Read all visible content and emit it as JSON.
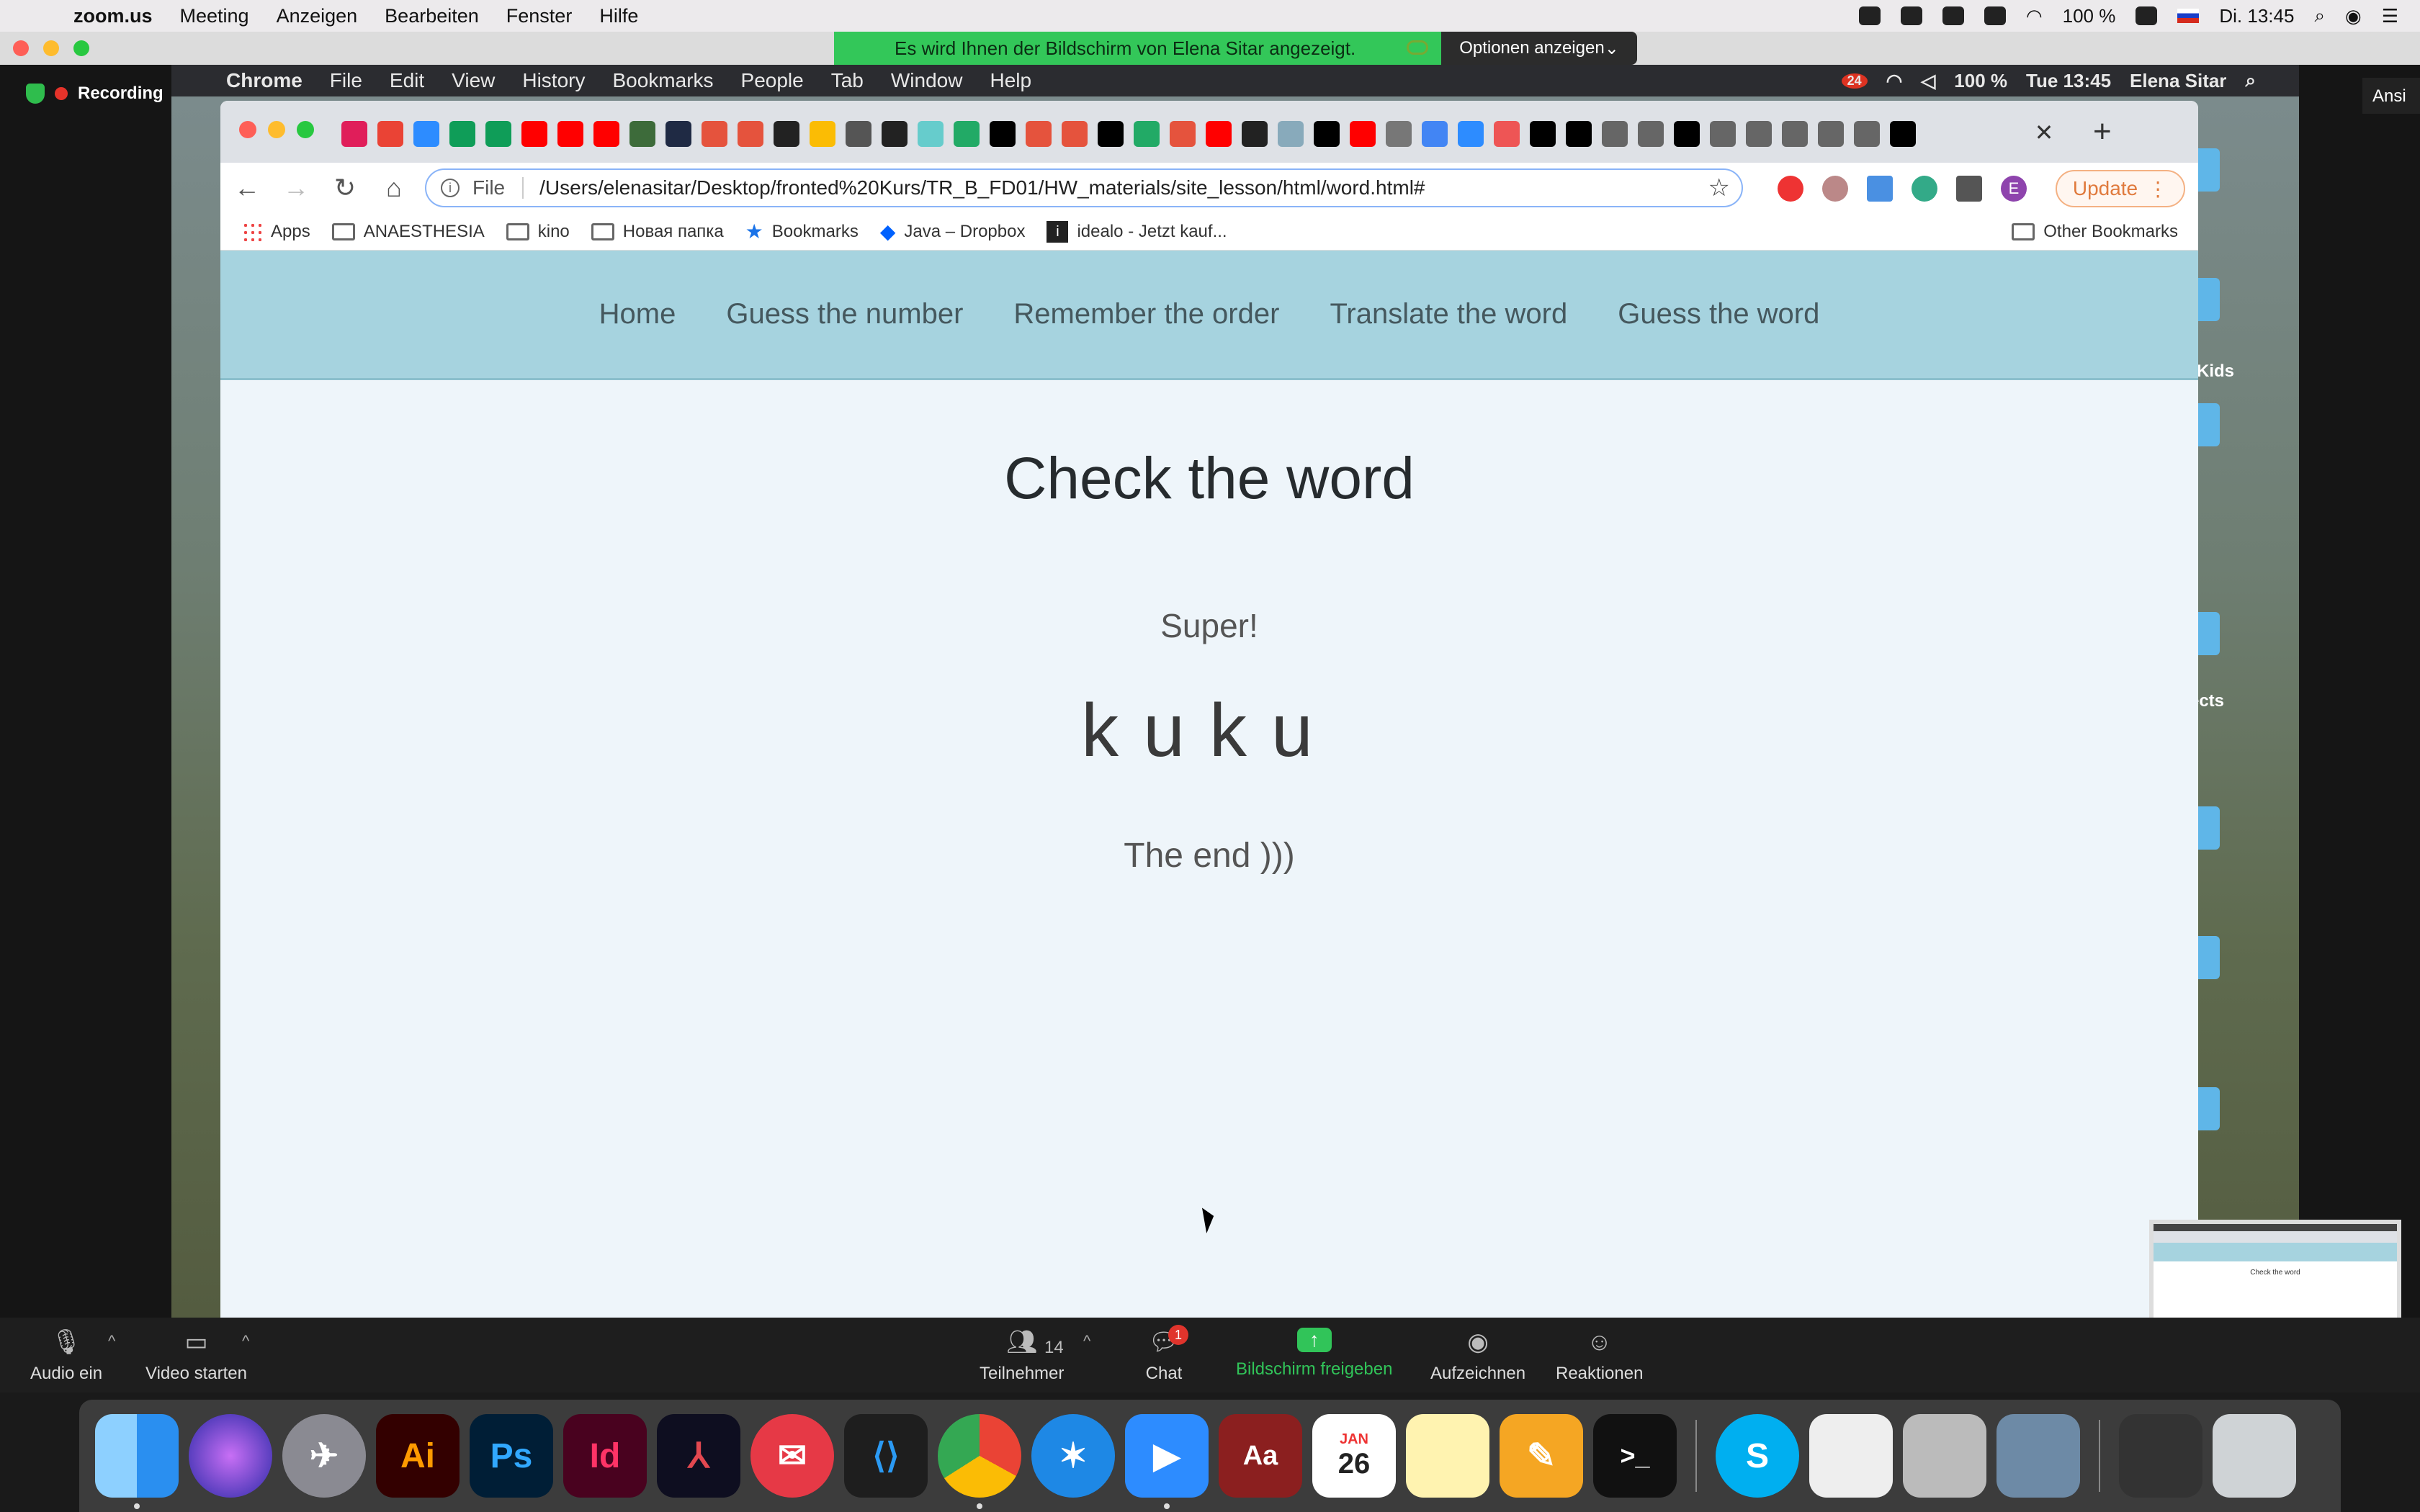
{
  "host_menubar": {
    "app": "zoom.us",
    "items": [
      "Meeting",
      "Anzeigen",
      "Bearbeiten",
      "Fenster",
      "Hilfe"
    ],
    "battery": "100 %",
    "clock": "Di. 13:45"
  },
  "share_banner": {
    "text": "Es wird Ihnen der Bildschirm von Elena Sitar angezeigt.",
    "options_label": "Optionen anzeigen"
  },
  "zoom": {
    "recording_label": "Recording",
    "view_label": "Ansi",
    "controls": {
      "audio": "Audio ein",
      "video": "Video starten",
      "participants": "Teilnehmer",
      "participants_count": "14",
      "chat": "Chat",
      "chat_badge": "1",
      "share": "Bildschirm freigeben",
      "record": "Aufzeichnen",
      "reactions": "Reaktionen"
    }
  },
  "remote_menubar": {
    "app": "Chrome",
    "items": [
      "File",
      "Edit",
      "View",
      "History",
      "Bookmarks",
      "People",
      "Tab",
      "Window",
      "Help"
    ],
    "battery": "100 %",
    "clock": "Tue 13:45",
    "user": "Elena Sitar",
    "notif_count": "24"
  },
  "desktop_labels": {
    "orkids": "orKids",
    "jects": "jects"
  },
  "browser": {
    "url_scheme": "File",
    "url": "/Users/elenasitar/Desktop/fronted%20Kurs/TR_B_FD01/HW_materials/site_lesson/html/word.html#",
    "update_label": "Update",
    "profile_initial": "E",
    "bookmarks": [
      "Apps",
      "ANAESTHESIA",
      "kino",
      "Новая папка",
      "Bookmarks",
      "Java – Dropbox",
      "idealo - Jetzt kauf..."
    ],
    "other_bookmarks": "Other Bookmarks"
  },
  "site": {
    "nav": [
      "Home",
      "Guess the number",
      "Remember the order",
      "Translate the word",
      "Guess the word"
    ],
    "heading": "Check the word",
    "message": "Super!",
    "word": "kuku",
    "ending": "The end )))"
  },
  "thumbnail": {
    "title": "Check the word"
  },
  "dock": {
    "calendar_month": "JAN",
    "calendar_day": "26",
    "dictionary_label": "Aa",
    "illustrator_label": "Ai",
    "photoshop_label": "Ps",
    "indesign_label": "Id",
    "skype_label": "S"
  }
}
